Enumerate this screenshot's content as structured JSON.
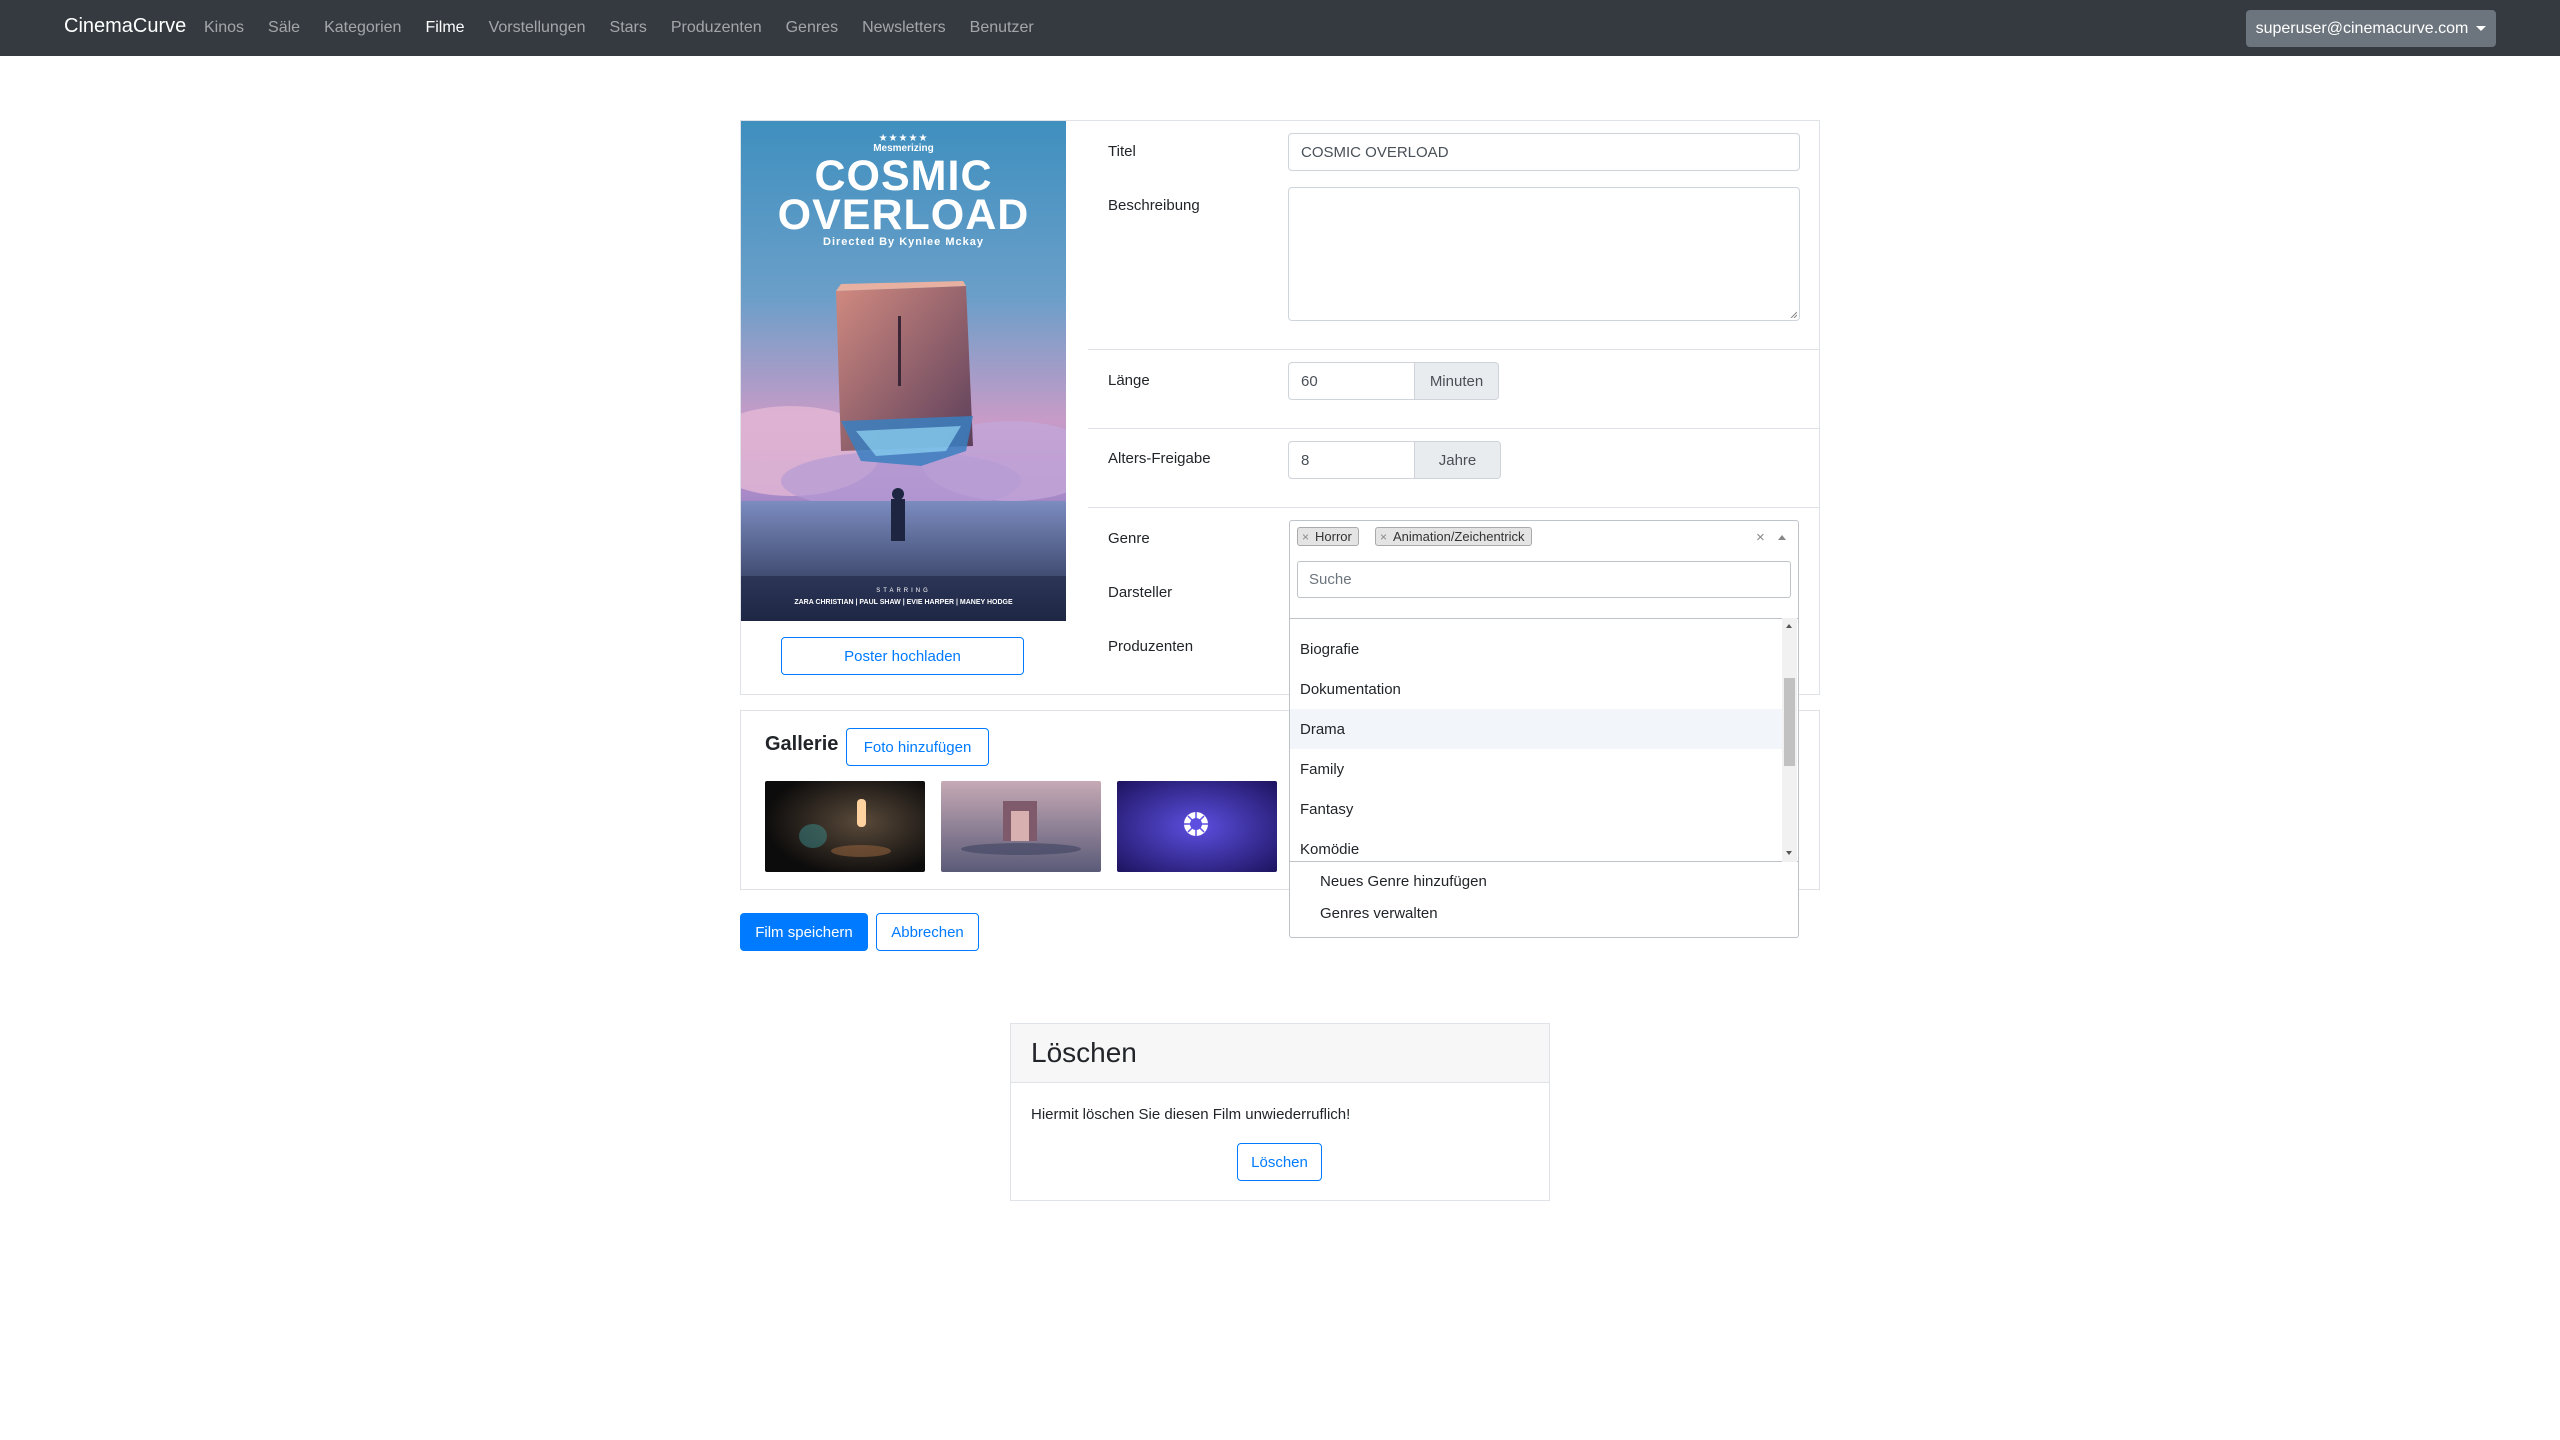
{
  "navbar": {
    "brand": "CinemaCurve",
    "links": [
      "Kinos",
      "Säle",
      "Kategorien",
      "Filme",
      "Vorstellungen",
      "Stars",
      "Produzenten",
      "Genres",
      "Newsletters",
      "Benutzer"
    ],
    "active": "Filme",
    "user": "superuser@cinemacurve.com"
  },
  "poster": {
    "stars": "★★★★★",
    "tagline": "Mesmerizing",
    "title_line1": "COSMIC",
    "title_line2": "OVERLOAD",
    "directed": "Directed By Kynlee Mckay",
    "starring": "STARRING",
    "cast": "ZARA CHRISTIAN | PAUL SHAW | EVIE HARPER | MANEY HODGE",
    "upload_label": "Poster hochladen"
  },
  "form": {
    "title_label": "Titel",
    "title_value": "COSMIC OVERLOAD",
    "description_label": "Beschreibung",
    "description_value": "",
    "length_label": "Länge",
    "length_value": "60",
    "length_unit": "Minuten",
    "age_label": "Alters-Freigabe",
    "age_value": "8",
    "age_unit": "Jahre",
    "genre_label": "Genre",
    "actors_label": "Darsteller",
    "producers_label": "Produzenten"
  },
  "genre_select": {
    "selected": [
      "Horror",
      "Animation/Zeichentrick"
    ],
    "remove_glyph": "×",
    "clear_glyph": "×",
    "search_placeholder": "Suche",
    "options": [
      "Biografie",
      "Dokumentation",
      "Drama",
      "Family",
      "Fantasy",
      "Komödie"
    ],
    "highlighted": "Drama",
    "add_new": "Neues Genre hinzufügen",
    "manage": "Genres verwalten"
  },
  "gallery": {
    "title": "Gallerie",
    "add_label": "Foto hinzufügen"
  },
  "actions": {
    "save": "Film speichern",
    "cancel": "Abbrechen"
  },
  "delete": {
    "title": "Löschen",
    "text": "Hiermit löschen Sie diesen Film unwiederruflich!",
    "button": "Löschen"
  }
}
